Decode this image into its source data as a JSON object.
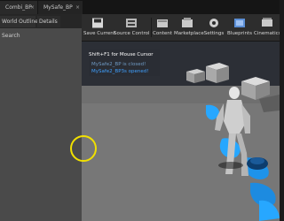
{
  "tabs": [
    {
      "label": "Combi_BP"
    },
    {
      "label": "MySafe_BP"
    }
  ],
  "left_panel": {
    "tabs": [
      "World Outliner",
      "Details"
    ],
    "search_hint": "Search"
  },
  "toolbar": {
    "buttons": [
      {
        "label": "Save Current",
        "icon": "save-icon"
      },
      {
        "label": "Source Control",
        "icon": "source-control-icon"
      },
      {
        "label": "Content",
        "icon": "content-icon"
      },
      {
        "label": "Marketplace",
        "icon": "marketplace-icon"
      },
      {
        "label": "Settings",
        "icon": "settings-icon"
      },
      {
        "label": "Blueprints",
        "icon": "blueprints-icon"
      },
      {
        "label": "Cinematics",
        "icon": "cinematics-icon"
      }
    ]
  },
  "viewport": {
    "hint": "Shift+F1 for Mouse Cursor",
    "msg1": "MySafe2_BP is closed!",
    "msg2": "MySafe2_BP3s opened!"
  },
  "colors": {
    "accent_blue": "#27a7ff",
    "cursor_ring": "#f1e000"
  }
}
